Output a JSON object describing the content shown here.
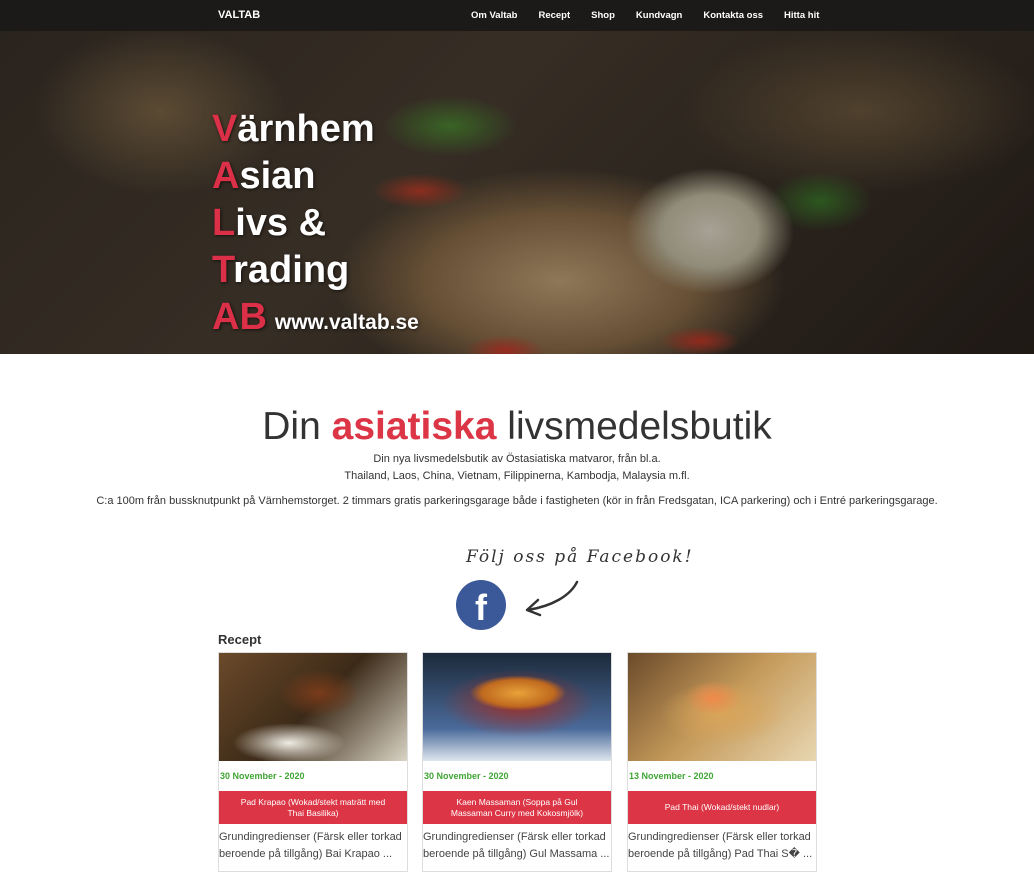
{
  "nav": {
    "brand": "VALTAB",
    "links": [
      "Om Valtab",
      "Recept",
      "Shop",
      "Kundvagn",
      "Kontakta oss",
      "Hitta hit"
    ]
  },
  "hero": {
    "lines": [
      {
        "cap": "V",
        "rest": "ärnhem"
      },
      {
        "cap": "A",
        "rest": "sian"
      },
      {
        "cap": "L",
        "rest": "ivs &"
      },
      {
        "cap": "T",
        "rest": "rading"
      },
      {
        "cap": "AB",
        "rest": ""
      }
    ],
    "website": "www.valtab.se"
  },
  "headline": {
    "before": "Din",
    "accent": "asiatiska",
    "after": "livsmedelsbutik"
  },
  "intro": {
    "line1": "Din nya livsmedelsbutik av Östasiatiska matvaror, från bl.a.",
    "line2": "Thailand, Laos, China, Vietnam, Filippinerna, Kambodja, Malaysia m.fl.",
    "line3": "C:a 100m från bussknutpunkt på Värnhemstorget. 2 timmars gratis parkeringsgarage både i fastigheten (kör in från Fredsgatan, ICA parkering) och i Entré parkeringsgarage."
  },
  "facebook": {
    "text": "Följ oss på Facebook!",
    "icon": "facebook-icon"
  },
  "recipes": {
    "title": "Recept",
    "cards": [
      {
        "date": "30 November - 2020",
        "name": "Pad Krapao (Wokad/stekt maträtt med Thai Basilika)",
        "line1": "Grundingredienser (Färsk eller torkad",
        "line2": "beroende på tillgång) Bai Krapao ..."
      },
      {
        "date": "30 November - 2020",
        "name": "Kaen Massaman (Soppa på Gul Massaman Curry med Kokosmjölk)",
        "line1": "Grundingredienser (Färsk eller torkad",
        "line2": "beroende på tillgång) Gul Massama ..."
      },
      {
        "date": "13 November - 2020",
        "name": "Pad Thai (Wokad/stekt nudlar)",
        "line1": "Grundingredienser (Färsk eller torkad",
        "line2": "beroende på tillgång) Pad Thai S� ..."
      }
    ]
  },
  "colors": {
    "accent": "#dc3545",
    "date": "#3fa535",
    "facebook": "#3b5998",
    "nav": "#1b1a18"
  }
}
